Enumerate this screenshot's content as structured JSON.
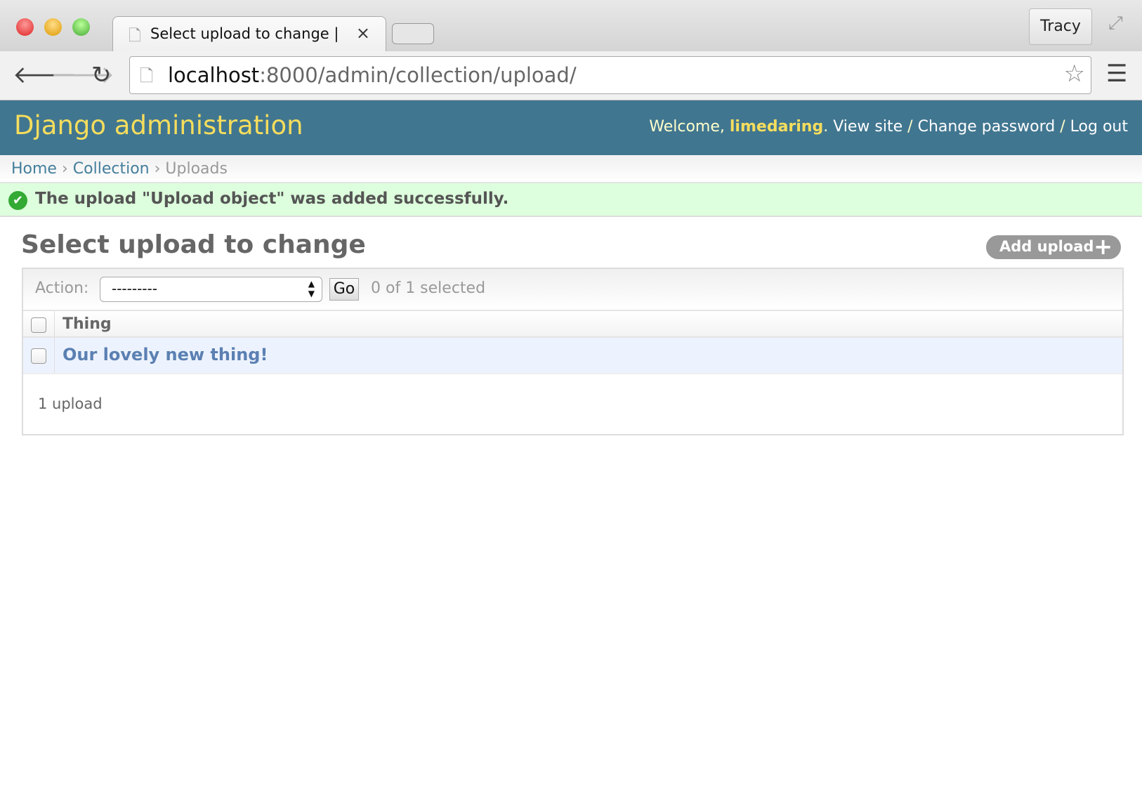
{
  "browser": {
    "tab_title": "Select upload to change | Django site admin",
    "tab_close": "×",
    "user": "Tracy",
    "url_host": "localhost",
    "url_path": ":8000/admin/collection/upload/",
    "colors": {
      "close": "#e0443e",
      "minimize": "#dea123",
      "maximize": "#5ab543"
    }
  },
  "header": {
    "brand": "Django administration",
    "welcome": "Welcome,",
    "username": "limedaring",
    "view_site": "View site",
    "change_password": "Change password",
    "log_out": "Log out",
    "sep": "/",
    "bg": "#417690"
  },
  "breadcrumbs": {
    "items": [
      "Home",
      "Collection",
      "Uploads"
    ],
    "sep": "›"
  },
  "message": {
    "text": "The upload \"Upload object\" was added successfully.",
    "icon": "check-circle-icon"
  },
  "page": {
    "title": "Select upload to change",
    "add_button": "Add upload",
    "add_icon": "+"
  },
  "actions": {
    "label": "Action:",
    "selected": "---------",
    "go": "Go",
    "counter": "0 of 1 selected"
  },
  "table": {
    "columns": [
      "Thing"
    ],
    "rows": [
      {
        "thing": "Our lovely new thing!"
      }
    ]
  },
  "paginator": "1 upload"
}
